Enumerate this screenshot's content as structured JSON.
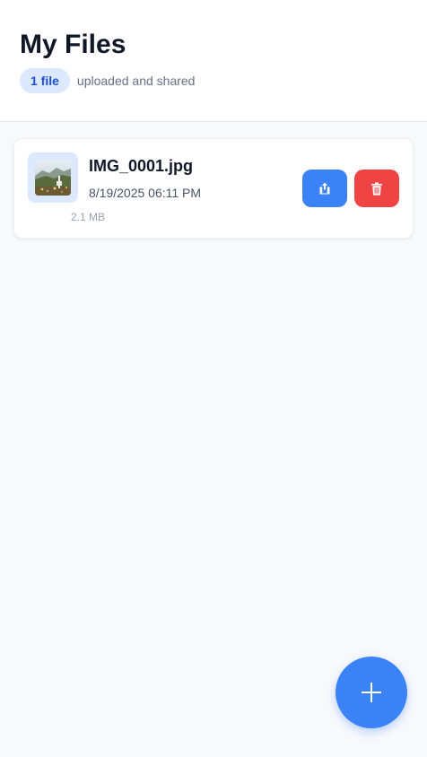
{
  "header": {
    "title": "My Files",
    "count_badge": "1 file",
    "count_suffix": "uploaded and shared"
  },
  "files": [
    {
      "name": "IMG_0001.jpg",
      "date": "8/19/2025 06:11 PM",
      "size": "2.1 MB",
      "thumbnail_icon": "image-thumbnail",
      "share_icon": "share-icon",
      "delete_icon": "trash-icon"
    }
  ],
  "fab": {
    "icon": "plus-icon"
  },
  "colors": {
    "accent": "#3b82f6",
    "danger": "#ef4444",
    "badge_bg": "#dbe8fe",
    "badge_text": "#1d4ed8",
    "background": "#f8f9fb"
  }
}
